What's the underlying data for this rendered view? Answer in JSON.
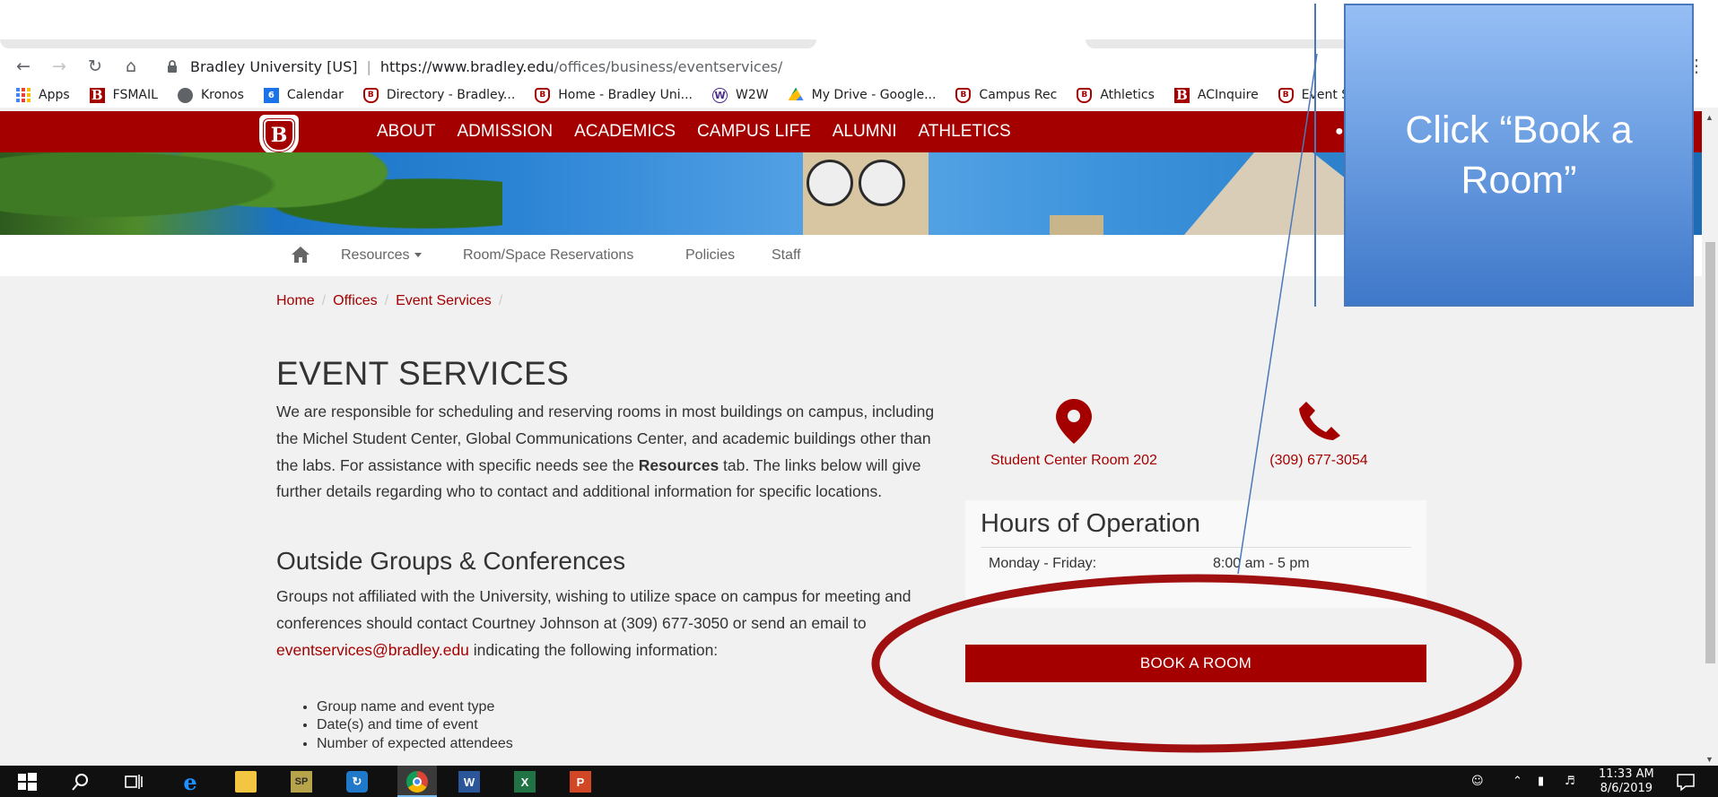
{
  "browser": {
    "site_label": "Bradley University [US]",
    "url_host": "https://www.bradley.edu",
    "url_path": "/offices/business/eventservices/",
    "bookmarks": [
      {
        "label": "Apps",
        "icon": "apps-grid-icon"
      },
      {
        "label": "FSMAIL",
        "icon": "bradley-b-icon"
      },
      {
        "label": "Kronos",
        "icon": "globe-icon"
      },
      {
        "label": "Calendar",
        "icon": "calendar-icon"
      },
      {
        "label": "Directory - Bradley...",
        "icon": "bradley-shield-icon"
      },
      {
        "label": "Home - Bradley Uni...",
        "icon": "bradley-shield-icon"
      },
      {
        "label": "W2W",
        "icon": "w2w-icon"
      },
      {
        "label": "My Drive - Google...",
        "icon": "google-drive-icon"
      },
      {
        "label": "Campus Rec",
        "icon": "bradley-shield-icon"
      },
      {
        "label": "Athletics",
        "icon": "bradley-shield-icon"
      },
      {
        "label": "ACInquire",
        "icon": "bradley-b-icon"
      },
      {
        "label": "Event S",
        "icon": "bradley-shield-icon"
      }
    ],
    "calendar_day": "6"
  },
  "site": {
    "logo_letter": "B",
    "main_nav": [
      "ABOUT",
      "ADMISSION",
      "ACADEMICS",
      "CAMPUS LIFE",
      "ALUMNI",
      "ATHLETICS"
    ],
    "sub_nav": {
      "resources": "Resources",
      "room_reservations": "Room/Space Reservations",
      "policies": "Policies",
      "staff": "Staff"
    },
    "breadcrumb": [
      "Home",
      "Offices",
      "Event Services"
    ],
    "page_title": "EVENT SERVICES",
    "intro_before": "We are responsible for scheduling and reserving rooms in most buildings on campus, including the Michel Student Center, Global Communications Center, and academic buildings other than the labs. For assistance with specific needs see the ",
    "intro_bold": "Resources",
    "intro_after": " tab. The links below will give further details regarding who to contact and additional information for specific locations.",
    "section_title": "Outside Groups & Conferences",
    "outside_before": "Groups not affiliated with the University, wishing to utilize space on campus for meeting and conferences should contact Courtney Johnson at (309) 677-3050 or send an email to ",
    "outside_email": "eventservices@bradley.edu",
    "outside_after": " indicating the following information:",
    "bullets": [
      "Group name and event type",
      "Date(s) and time of event",
      "Number of expected attendees"
    ],
    "location_label": "Student Center Room 202",
    "phone_label": "(309) 677-3054",
    "hours_title": "Hours of Operation",
    "hours_day": "Monday - Friday:",
    "hours_time": "8:00 am - 5 pm",
    "book_button": "BOOK A ROOM"
  },
  "annotation": {
    "callout_text": "Click “Book a Room”"
  },
  "taskbar": {
    "time": "11:33 AM",
    "date": "8/6/2019"
  },
  "colors": {
    "brand_red": "#a50000",
    "callout_blue": "#6d9fe2",
    "ellipse_red": "#a01010"
  }
}
